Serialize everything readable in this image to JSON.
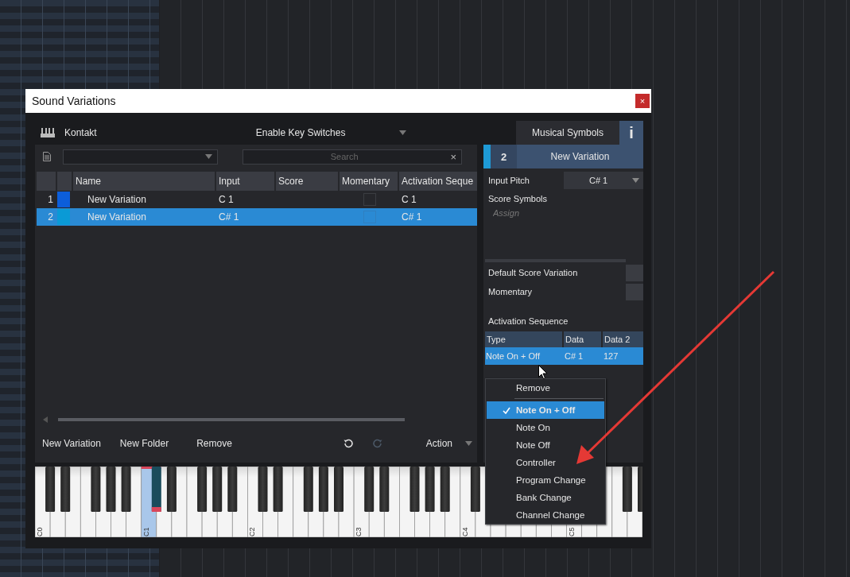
{
  "window": {
    "title": "Sound Variations",
    "close": "×"
  },
  "toolbar": {
    "instrument": "Kontakt",
    "key_switch_menu": "Enable Key Switches",
    "tabs": [
      {
        "label": "Musical Symbols",
        "selected": false
      },
      {
        "label": "i",
        "selected": true
      }
    ]
  },
  "search": {
    "placeholder": "Search",
    "clear": "×"
  },
  "table": {
    "columns": [
      "Name",
      "Input",
      "Score",
      "Momentary",
      "Activation Seque"
    ],
    "rows": [
      {
        "index": "1",
        "color": "#0c5edb",
        "name": "New Variation",
        "input": "C 1",
        "momentary": false,
        "activation": "C 1",
        "selected": false
      },
      {
        "index": "2",
        "color": "#0a9ad6",
        "name": "New Variation",
        "input": "C# 1",
        "momentary": false,
        "activation": "C# 1",
        "selected": true
      }
    ]
  },
  "bottom_actions": [
    "New Variation",
    "New Folder",
    "Remove"
  ],
  "redo_disabled": true,
  "action_menu": "Action",
  "detail": {
    "index": "2",
    "name": "New Variation",
    "input_pitch": {
      "label": "Input Pitch",
      "value": "C# 1"
    },
    "score_symbols": {
      "label": "Score Symbols",
      "placeholder": "Assign"
    },
    "options": [
      {
        "label": "Default Score Variation",
        "checked": false
      },
      {
        "label": "Momentary",
        "checked": false
      }
    ],
    "activation_sequence": {
      "title": "Activation Sequence",
      "columns": [
        "Type",
        "Data",
        "Data 2"
      ],
      "rows": [
        {
          "type": "Note On + Off",
          "data": "C# 1",
          "data_2": "127",
          "selected": true
        }
      ]
    }
  },
  "context_menu": [
    {
      "kind": "action",
      "label": "Remove"
    },
    {
      "kind": "separator"
    },
    {
      "kind": "option",
      "label": "Note On + Off",
      "checked": true
    },
    {
      "kind": "option",
      "label": "Note On",
      "checked": false
    },
    {
      "kind": "option",
      "label": "Note Off",
      "checked": false
    },
    {
      "kind": "option",
      "label": "Controller",
      "checked": false
    },
    {
      "kind": "option",
      "label": "Program Change",
      "checked": false
    },
    {
      "kind": "option",
      "label": "Bank Change",
      "checked": false
    },
    {
      "kind": "option",
      "label": "Channel Change",
      "checked": false
    }
  ],
  "keyboard": {
    "octaves": [
      {
        "label": "C0",
        "selected": false
      },
      {
        "label": "C1",
        "selected": true
      },
      {
        "label": "C2",
        "selected": false
      },
      {
        "label": "C3",
        "selected": false
      },
      {
        "label": "C4",
        "selected": false
      },
      {
        "label": "C5",
        "selected": false
      }
    ]
  }
}
